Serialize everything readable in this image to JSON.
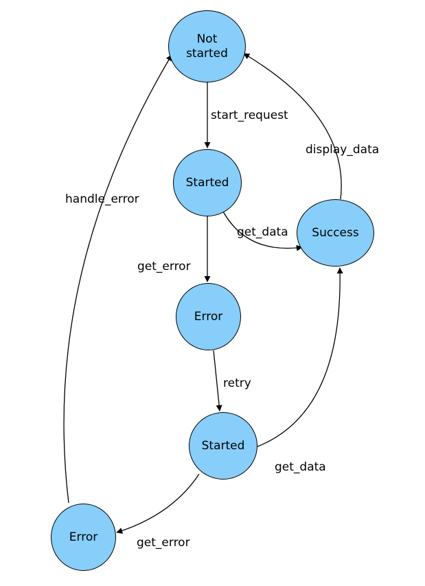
{
  "nodes": {
    "not_started": {
      "label": "Not\nstarted"
    },
    "started1": {
      "label": "Started"
    },
    "success": {
      "label": "Success"
    },
    "error1": {
      "label": "Error"
    },
    "started2": {
      "label": "Started"
    },
    "error2": {
      "label": "Error"
    }
  },
  "edges": {
    "start_request": {
      "label": "start_request"
    },
    "get_data1": {
      "label": "get_data"
    },
    "get_error1": {
      "label": "get_error"
    },
    "display_data": {
      "label": "display_data"
    },
    "retry": {
      "label": "retry"
    },
    "get_data2": {
      "label": "get_data"
    },
    "get_error2": {
      "label": "get_error"
    },
    "handle_error": {
      "label": "handle_error"
    }
  },
  "colors": {
    "node_fill": "#87cefa",
    "edge_stroke": "#000000"
  }
}
